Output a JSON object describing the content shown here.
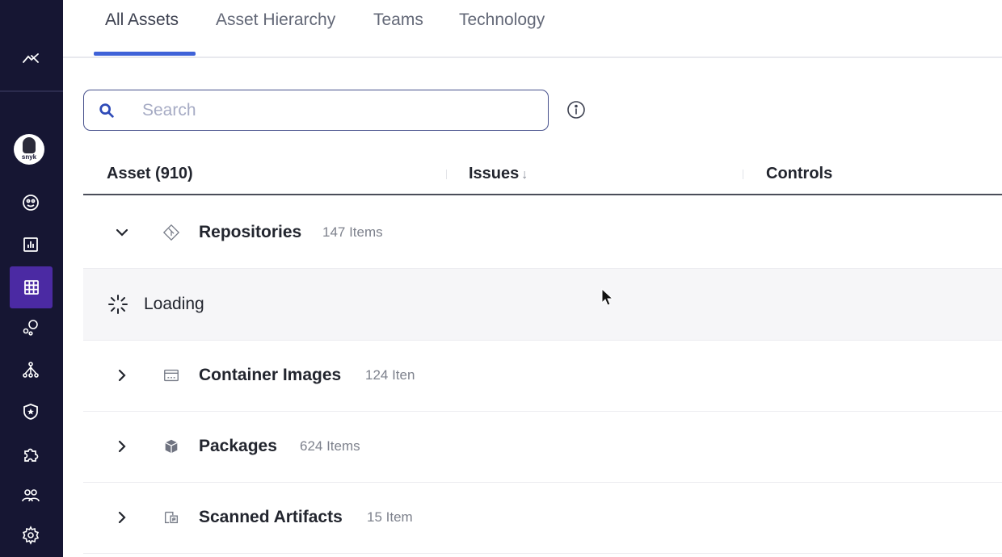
{
  "sidebar": {
    "icons": [
      "trend-icon",
      "avatar",
      "dashboard-icon",
      "reports-icon",
      "inventory-grid-icon",
      "bubbles-icon",
      "hierarchy-icon",
      "shield-star-icon",
      "puzzle-icon",
      "people-icon",
      "gear-icon"
    ],
    "avatar_text": "snyk"
  },
  "tabs": {
    "all_assets": "All Assets",
    "asset_hierarchy": "Asset Hierarchy",
    "teams": "Teams",
    "technology": "Technology"
  },
  "search": {
    "placeholder": "Search"
  },
  "table": {
    "headers": {
      "asset": "Asset (910)",
      "issues": "Issues",
      "controls": "Controls"
    },
    "sort_arrow": "↓",
    "rows": [
      {
        "name": "Repositories",
        "count": "147 Items",
        "icon": "git-diamond-icon",
        "expanded": true
      },
      {
        "loading_text": "Loading"
      },
      {
        "name": "Container Images",
        "count": "124 Iten",
        "icon": "container-icon",
        "expanded": false
      },
      {
        "name": "Packages",
        "count": "624 Items",
        "icon": "package-box-icon",
        "expanded": false
      },
      {
        "name": "Scanned Artifacts",
        "count": "15 Item",
        "icon": "artifact-icon",
        "expanded": false
      }
    ]
  },
  "colors": {
    "sidebar_bg": "#161633",
    "sidebar_active": "#4b2aa3",
    "tab_accent": "#3f62d8",
    "search_border": "#46508c"
  }
}
